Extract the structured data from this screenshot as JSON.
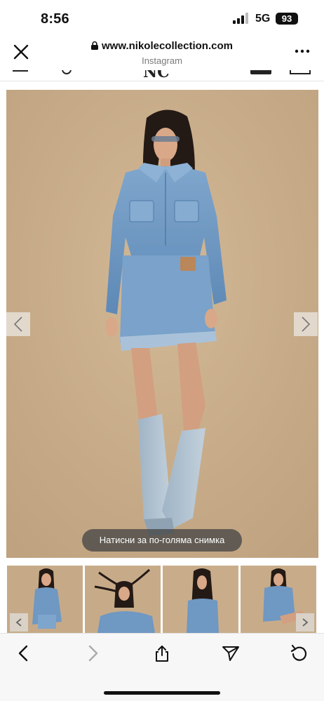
{
  "status_bar": {
    "time": "8:56",
    "network": "5G",
    "battery": "93"
  },
  "browser": {
    "url": "www.nikolecollection.com",
    "subtitle": "Instagram"
  },
  "site_header": {
    "logo": "NC"
  },
  "gallery": {
    "zoom_hint": "Натисни за по-голяма снимка",
    "thumbnail_count": 4
  },
  "icons": {
    "status": [
      "signal-icon"
    ],
    "header": [
      "close-icon",
      "lock-icon",
      "more-icon"
    ],
    "gallery": [
      "chevron-left-icon",
      "chevron-right-icon"
    ],
    "toolbar": [
      "back-icon",
      "forward-icon",
      "share-icon",
      "send-icon",
      "reload-icon"
    ]
  },
  "colors": {
    "backdrop": "#c8ad8b",
    "denim": "#6d97c2",
    "toolbar_bg": "#f7f7f7"
  }
}
